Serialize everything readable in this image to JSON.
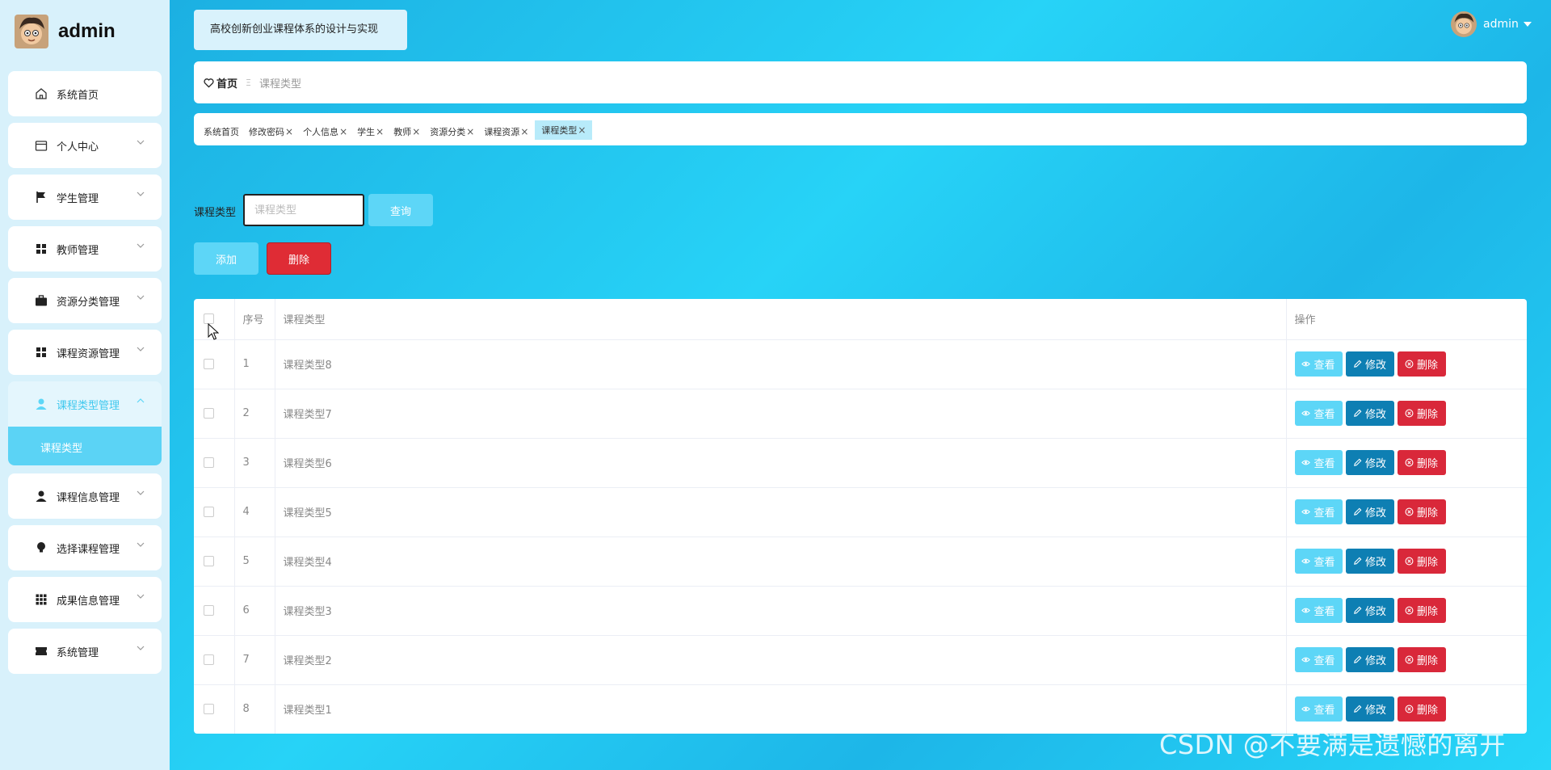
{
  "sidebar": {
    "brand": "admin",
    "items": [
      {
        "label": "系统首页"
      },
      {
        "label": "个人中心"
      },
      {
        "label": "学生管理"
      },
      {
        "label": "教师管理"
      },
      {
        "label": "资源分类管理"
      },
      {
        "label": "课程资源管理"
      },
      {
        "label": "课程类型管理"
      },
      {
        "label": "课程信息管理"
      },
      {
        "label": "选择课程管理"
      },
      {
        "label": "成果信息管理"
      },
      {
        "label": "系统管理"
      }
    ],
    "submenu": {
      "label": "课程类型"
    }
  },
  "header": {
    "title": "高校创新创业课程体系的设计与实现",
    "user": "admin"
  },
  "breadcrumb": {
    "home": "首页",
    "sep": "Ξ",
    "current": "课程类型"
  },
  "tags": [
    {
      "label": "系统首页",
      "closable": false
    },
    {
      "label": "修改密码",
      "closable": true
    },
    {
      "label": "个人信息",
      "closable": true
    },
    {
      "label": "学生",
      "closable": true
    },
    {
      "label": "教师",
      "closable": true
    },
    {
      "label": "资源分类",
      "closable": true
    },
    {
      "label": "课程资源",
      "closable": true
    },
    {
      "label": "课程类型",
      "closable": true,
      "active": true
    }
  ],
  "search": {
    "label": "课程类型",
    "placeholder": "课程类型",
    "query_label": "查询"
  },
  "actions": {
    "add_label": "添加",
    "delete_label": "删除"
  },
  "table": {
    "headers": {
      "index": "序号",
      "type": "课程类型",
      "ops": "操作"
    },
    "ops": {
      "view": "查看",
      "edit": "修改",
      "delete": "删除"
    },
    "rows": [
      {
        "index": "1",
        "type": "课程类型8"
      },
      {
        "index": "2",
        "type": "课程类型7"
      },
      {
        "index": "3",
        "type": "课程类型6"
      },
      {
        "index": "4",
        "type": "课程类型5"
      },
      {
        "index": "5",
        "type": "课程类型4"
      },
      {
        "index": "6",
        "type": "课程类型3"
      },
      {
        "index": "7",
        "type": "课程类型2"
      },
      {
        "index": "8",
        "type": "课程类型1"
      }
    ]
  },
  "watermark": "CSDN @不要满是遗憾的离开",
  "colors": {
    "accent": "#5dd6f7",
    "edit": "#0e7fb3",
    "danger": "#df2c35",
    "sidebar_bg": "#d8f1fb"
  }
}
